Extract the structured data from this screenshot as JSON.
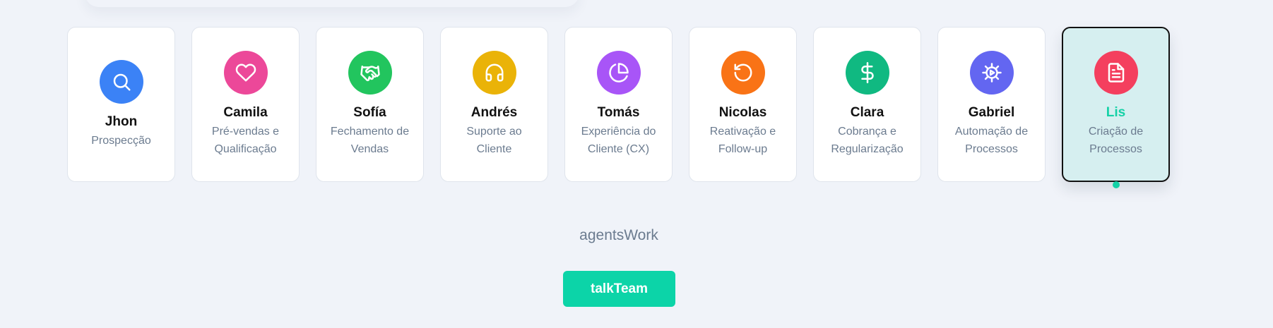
{
  "agents": [
    {
      "name": "Jhon",
      "role": "Prospecção",
      "color": "#3b82f6",
      "icon": "search-icon"
    },
    {
      "name": "Camila",
      "role": "Pré-vendas e Qualificação",
      "color": "#ec4899",
      "icon": "heart-icon"
    },
    {
      "name": "Sofía",
      "role": "Fechamento de Vendas",
      "color": "#22c55e",
      "icon": "handshake-icon"
    },
    {
      "name": "Andrés",
      "role": "Suporte ao Cliente",
      "color": "#eab308",
      "icon": "headphones-icon"
    },
    {
      "name": "Tomás",
      "role": "Experiência do Cliente (CX)",
      "color": "#a855f7",
      "icon": "pie-chart-icon"
    },
    {
      "name": "Nicolas",
      "role": "Reativação e Follow-up",
      "color": "#f97316",
      "icon": "rotate-ccw-icon"
    },
    {
      "name": "Clara",
      "role": "Cobrança e Regularização",
      "color": "#10b981",
      "icon": "dollar-sign-icon"
    },
    {
      "name": "Gabriel",
      "role": "Automação de Processos",
      "color": "#6366f1",
      "icon": "gear-icon"
    },
    {
      "name": "Lis",
      "role": "Criação de Processos",
      "color": "#f43f5e",
      "icon": "document-icon",
      "active": true
    }
  ],
  "section_label": "agentsWork",
  "talk_button_label": "talkTeam",
  "colors": {
    "accent": "#14d1a6",
    "button": "#0cd4a8",
    "background": "#f0f3f9"
  }
}
